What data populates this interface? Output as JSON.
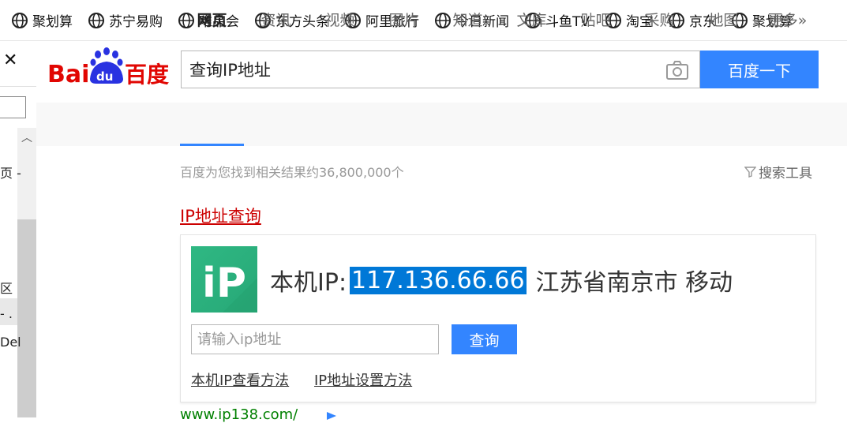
{
  "bookmarks": [
    {
      "label": "聚划算",
      "icon": "globe-icon"
    },
    {
      "label": "苏宁易购",
      "icon": "globe-icon"
    },
    {
      "label": "唯品会",
      "icon": "globe-icon"
    },
    {
      "label": "东方头条",
      "icon": "globe-icon"
    },
    {
      "label": "阿里旅行",
      "icon": "globe-icon"
    },
    {
      "label": "今日新闻",
      "icon": "globe-icon"
    },
    {
      "label": "斗鱼TV",
      "icon": "globe-icon"
    },
    {
      "label": "淘宝",
      "icon": "globe-icon"
    },
    {
      "label": "京东",
      "icon": "globe-icon"
    },
    {
      "label": "聚划算",
      "icon": "globe-icon"
    }
  ],
  "sidebar": {
    "close_glyph": "✕",
    "fragments": [
      "页 -",
      "区",
      "- .",
      "Del"
    ]
  },
  "search": {
    "query": "查询IP地址",
    "button_label": "百度一下"
  },
  "tabs": [
    {
      "label": "网页",
      "active": true
    },
    {
      "label": "资讯"
    },
    {
      "label": "视频"
    },
    {
      "label": "图片"
    },
    {
      "label": "知道"
    },
    {
      "label": "文库"
    },
    {
      "label": "贴吧"
    },
    {
      "label": "采购"
    },
    {
      "label": "地图"
    },
    {
      "label": "更多»"
    }
  ],
  "results": {
    "count_text": "百度为您找到相关结果约36,800,000个",
    "tools_label": "搜索工具",
    "first_title": "IP地址查询",
    "ip_card": {
      "prefix": "本机IP:",
      "ip": "117.136.66.66",
      "location": "江苏省南京市 移动",
      "input_placeholder": "请输入ip地址",
      "query_button": "查询",
      "links": [
        "本机IP查看方法",
        "IP地址设置方法"
      ]
    },
    "next_url": "www.ip138.com/"
  },
  "colors": {
    "accent": "#3385ff",
    "title_red": "#c00",
    "selection": "#0078d7",
    "ip_logo_green": "#2fb883"
  }
}
